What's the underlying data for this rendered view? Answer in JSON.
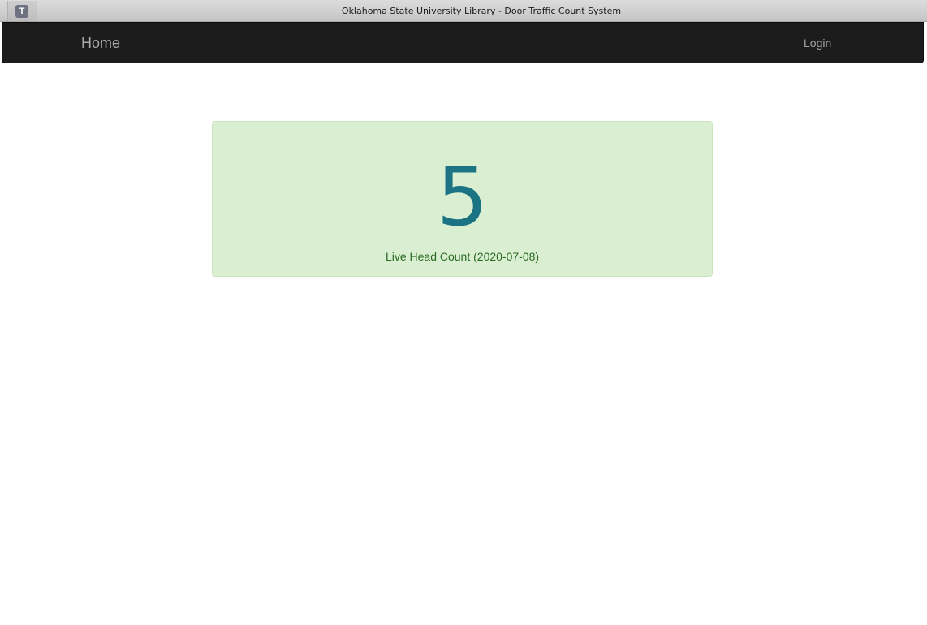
{
  "window": {
    "title": "Oklahoma State University Library - Door Traffic Count System",
    "app_icon_letter": "T",
    "app_icon_name": "tab-app-icon"
  },
  "navbar": {
    "brand_label": "Home",
    "login_label": "Login"
  },
  "headcount": {
    "value": "5",
    "caption": "Live Head Count (2020-07-08)"
  },
  "colors": {
    "navbar_background": "#1c1c1c",
    "panel_background": "#daefd1",
    "count_color": "#1b7384",
    "caption_color": "#2a6b22"
  }
}
